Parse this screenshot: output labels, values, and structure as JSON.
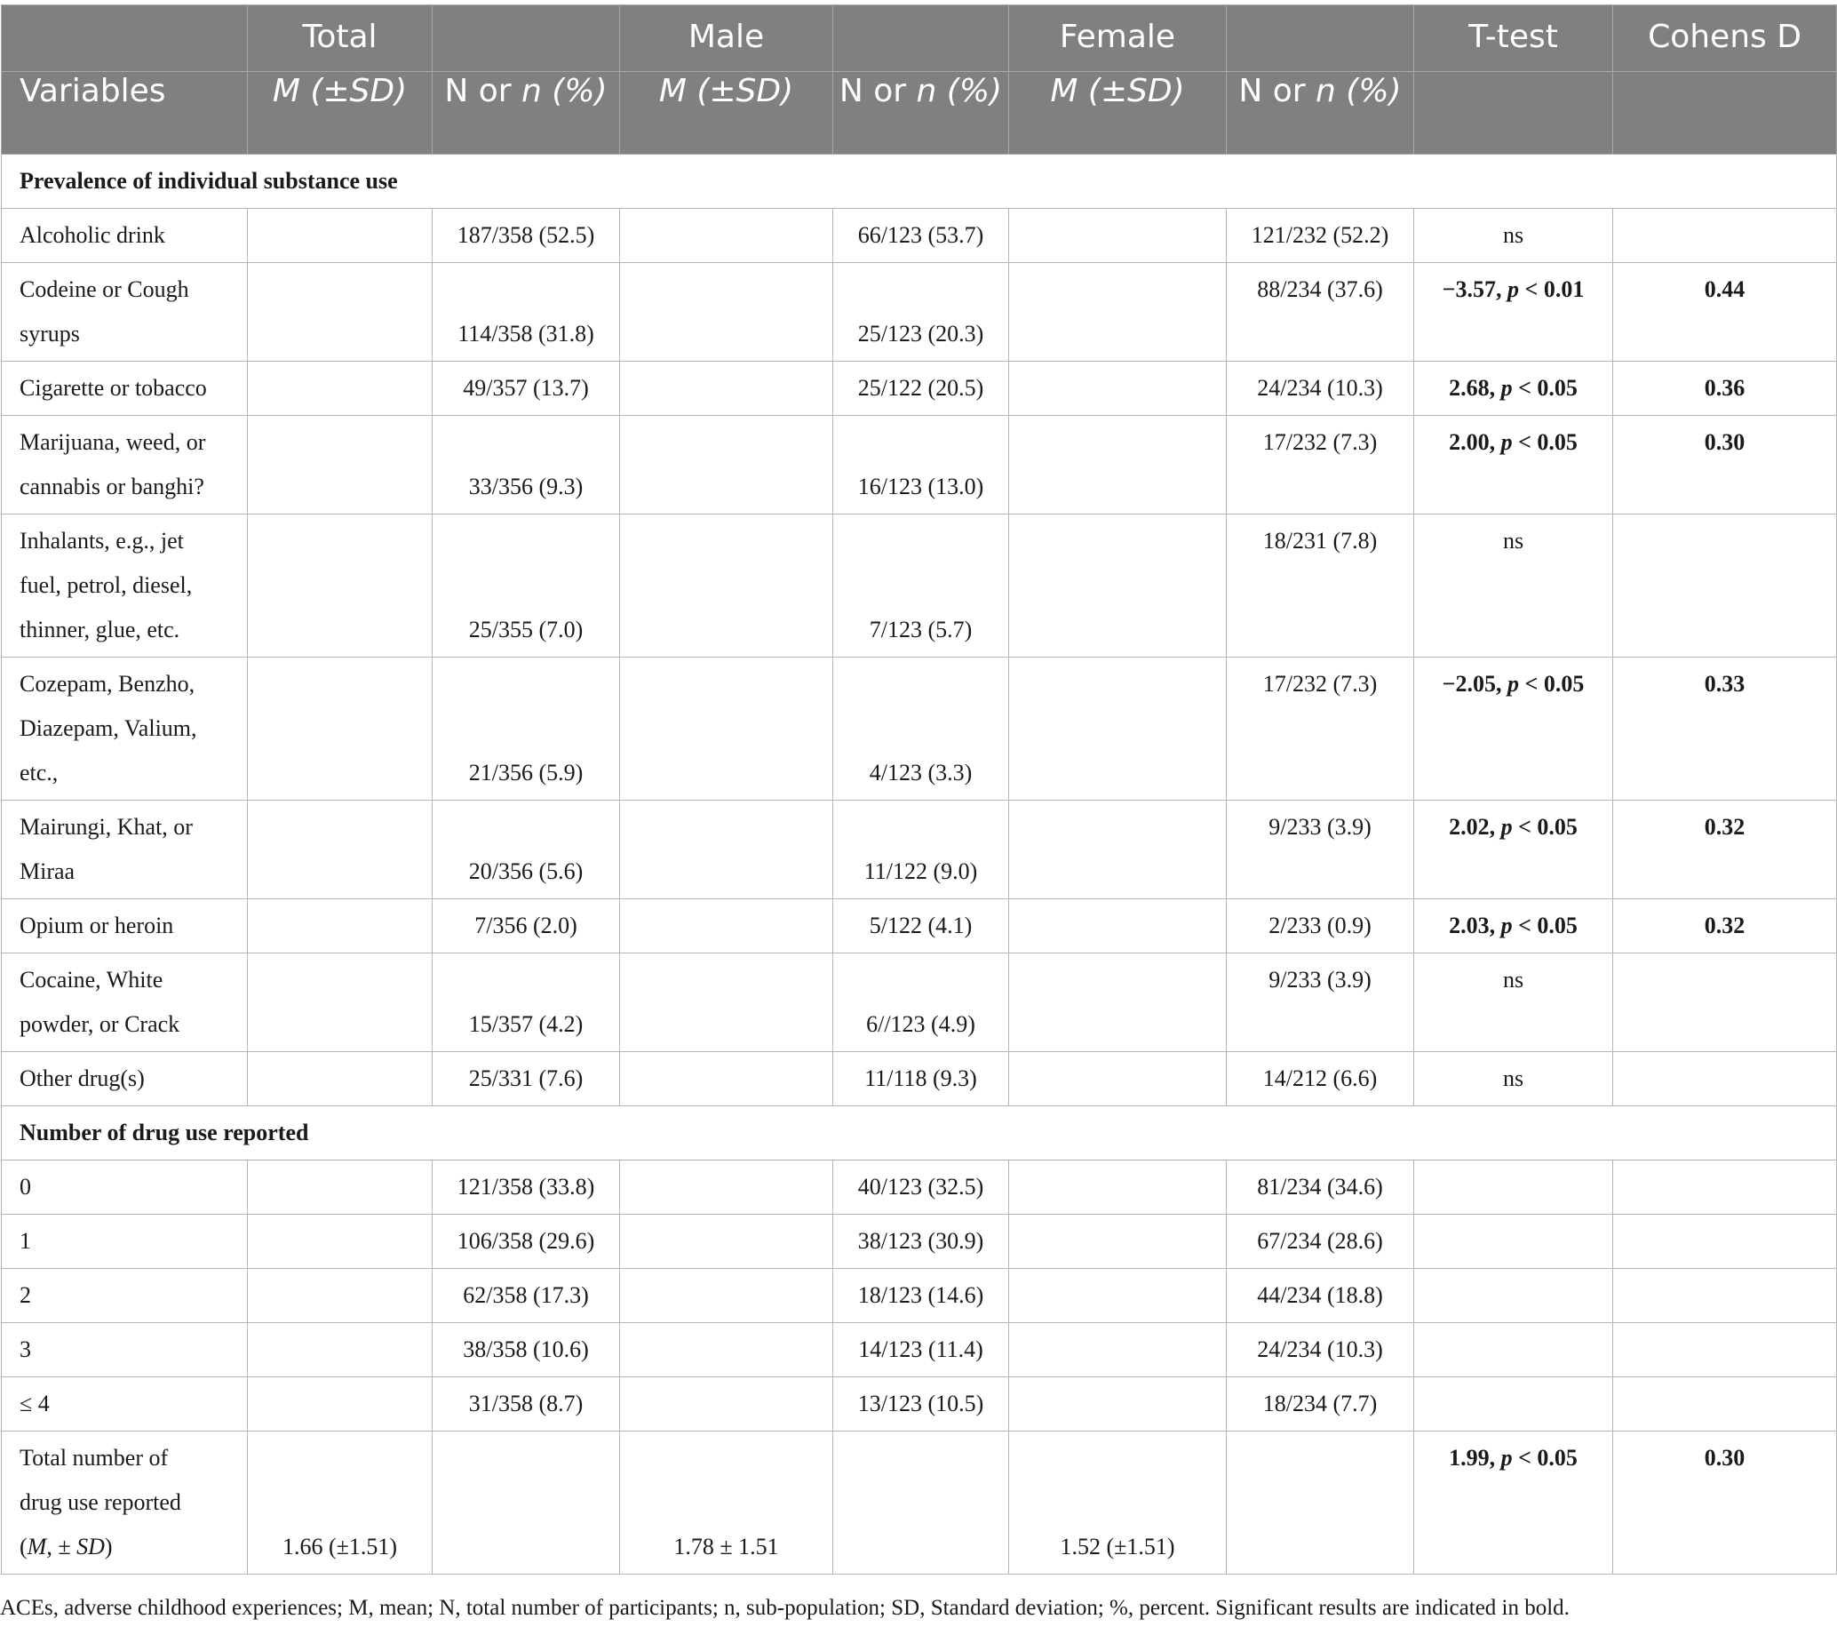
{
  "header": {
    "row1": [
      "",
      "Total",
      "",
      "Male",
      "",
      "Female",
      "",
      "T-test",
      "Cohens D"
    ],
    "row2": [
      "Variables",
      "M (±SD)",
      "N or n (%)",
      "M (±SD)",
      "N or n (%)",
      "M (±SD)",
      "N or n (%)",
      "",
      ""
    ]
  },
  "sections": [
    {
      "title": "Prevalence of individual substance use",
      "rows": [
        {
          "label": [
            "Alcoholic drink"
          ],
          "total_n": "187/358 (52.5)",
          "male_n": "66/123 (53.7)",
          "female_n": "121/232 (52.2)",
          "ttest": "ns",
          "ttest_bold": false,
          "d": ""
        },
        {
          "label": [
            "Codeine or Cough",
            "syrups"
          ],
          "total_n": "114/358 (31.8)",
          "male_n": "25/123 (20.3)",
          "female_n": "88/234 (37.6)",
          "ttest": "−3.57, p < 0.01",
          "ttest_bold": true,
          "d": "0.44"
        },
        {
          "label": [
            "Cigarette or tobacco"
          ],
          "total_n": "49/357 (13.7)",
          "male_n": "25/122 (20.5)",
          "female_n": "24/234 (10.3)",
          "ttest": "2.68, p < 0.05",
          "ttest_bold": true,
          "d": "0.36"
        },
        {
          "label": [
            "Marijuana, weed, or",
            "cannabis or banghi?"
          ],
          "total_n": "33/356 (9.3)",
          "male_n": "16/123 (13.0)",
          "female_n": "17/232 (7.3)",
          "ttest": "2.00, p < 0.05",
          "ttest_bold": true,
          "d": "0.30"
        },
        {
          "label": [
            "Inhalants, e.g., jet",
            "fuel, petrol, diesel,",
            "thinner, glue, etc."
          ],
          "total_n": "25/355 (7.0)",
          "male_n": "7/123 (5.7)",
          "female_n": "18/231 (7.8)",
          "ttest": "ns",
          "ttest_bold": false,
          "d": ""
        },
        {
          "label": [
            "Cozepam, Benzho,",
            "Diazepam, Valium,",
            "etc.,"
          ],
          "total_n": "21/356 (5.9)",
          "male_n": "4/123 (3.3)",
          "female_n": "17/232 (7.3)",
          "ttest": "−2.05, p < 0.05",
          "ttest_bold": true,
          "d": "0.33"
        },
        {
          "label": [
            "Mairungi, Khat, or",
            "Miraa"
          ],
          "total_n": "20/356 (5.6)",
          "male_n": "11/122 (9.0)",
          "female_n": "9/233 (3.9)",
          "ttest": "2.02, p < 0.05",
          "ttest_bold": true,
          "d": "0.32"
        },
        {
          "label": [
            "Opium or heroin"
          ],
          "total_n": "7/356 (2.0)",
          "male_n": "5/122 (4.1)",
          "female_n": "2/233 (0.9)",
          "ttest": "2.03, p < 0.05",
          "ttest_bold": true,
          "d": "0.32"
        },
        {
          "label": [
            "Cocaine, White",
            "powder, or Crack"
          ],
          "total_n": "15/357 (4.2)",
          "male_n": "6//123 (4.9)",
          "female_n": "9/233 (3.9)",
          "ttest": "ns",
          "ttest_bold": false,
          "d": ""
        },
        {
          "label": [
            "Other drug(s)"
          ],
          "total_n": "25/331 (7.6)",
          "male_n": "11/118 (9.3)",
          "female_n": "14/212 (6.6)",
          "ttest": "ns",
          "ttest_bold": false,
          "d": ""
        }
      ]
    },
    {
      "title": "Number of drug use reported",
      "rows": [
        {
          "label": [
            "0"
          ],
          "total_n": "121/358 (33.8)",
          "male_n": "40/123 (32.5)",
          "female_n": "81/234 (34.6)",
          "ttest": "",
          "ttest_bold": false,
          "d": ""
        },
        {
          "label": [
            "1"
          ],
          "total_n": "106/358 (29.6)",
          "male_n": "38/123 (30.9)",
          "female_n": "67/234 (28.6)",
          "ttest": "",
          "ttest_bold": false,
          "d": ""
        },
        {
          "label": [
            "2"
          ],
          "total_n": "62/358 (17.3)",
          "male_n": "18/123 (14.6)",
          "female_n": "44/234 (18.8)",
          "ttest": "",
          "ttest_bold": false,
          "d": ""
        },
        {
          "label": [
            "3"
          ],
          "total_n": "38/358 (10.6)",
          "male_n": "14/123 (11.4)",
          "female_n": "24/234 (10.3)",
          "ttest": "",
          "ttest_bold": false,
          "d": ""
        },
        {
          "label": [
            "≤ 4"
          ],
          "total_n": "31/358 (8.7)",
          "male_n": "13/123 (10.5)",
          "female_n": "18/234 (7.7)",
          "ttest": "",
          "ttest_bold": false,
          "d": ""
        }
      ]
    }
  ],
  "total_row": {
    "label": [
      "Total number of",
      "drug use reported",
      "(M, ± SD)"
    ],
    "total_m": "1.66 (±1.51)",
    "male_m": "1.78 ± 1.51",
    "female_m": "1.52 (±1.51)",
    "ttest": "1.99, p < 0.05",
    "d": "0.30"
  },
  "footnote": "ACEs, adverse childhood experiences; M, mean; N, total number of participants; n, sub-population; SD, Standard deviation; %, percent. Significant results are indicated in bold."
}
